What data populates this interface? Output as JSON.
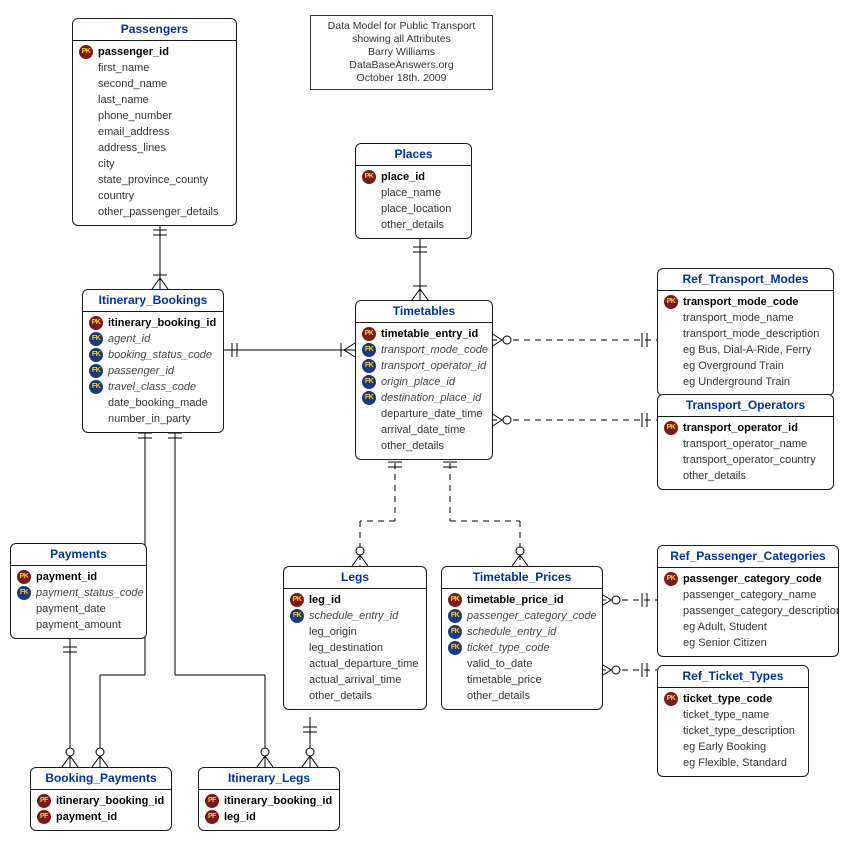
{
  "caption": {
    "line1": "Data Model for Public Transport",
    "line2": "showing all Attributes",
    "line3": "Barry Williams",
    "line4": "DataBaseAnswers.org",
    "line5": "October 18th. 2009"
  },
  "entities": {
    "passengers": {
      "title": "Passengers",
      "attrs": [
        {
          "key": "PK",
          "name": "passenger_id",
          "bold": true
        },
        {
          "key": null,
          "name": "first_name"
        },
        {
          "key": null,
          "name": "second_name"
        },
        {
          "key": null,
          "name": "last_name"
        },
        {
          "key": null,
          "name": "phone_number"
        },
        {
          "key": null,
          "name": "email_address"
        },
        {
          "key": null,
          "name": "address_lines"
        },
        {
          "key": null,
          "name": "city"
        },
        {
          "key": null,
          "name": "state_province_county"
        },
        {
          "key": null,
          "name": "country"
        },
        {
          "key": null,
          "name": "other_passenger_details"
        }
      ]
    },
    "itinerary_bookings": {
      "title": "Itinerary_Bookings",
      "attrs": [
        {
          "key": "PK",
          "name": "itinerary_booking_id",
          "bold": true
        },
        {
          "key": "FK",
          "name": "agent_id",
          "italic": true
        },
        {
          "key": "FK",
          "name": "booking_status_code",
          "italic": true
        },
        {
          "key": "FK",
          "name": "passenger_id",
          "italic": true
        },
        {
          "key": "FK",
          "name": "travel_class_code",
          "italic": true
        },
        {
          "key": null,
          "name": "date_booking_made"
        },
        {
          "key": null,
          "name": "number_in_party"
        }
      ]
    },
    "payments": {
      "title": "Payments",
      "attrs": [
        {
          "key": "PK",
          "name": "payment_id",
          "bold": true
        },
        {
          "key": "FK",
          "name": "payment_status_code",
          "italic": true
        },
        {
          "key": null,
          "name": "payment_date"
        },
        {
          "key": null,
          "name": "payment_amount"
        }
      ]
    },
    "booking_payments": {
      "title": "Booking_Payments",
      "attrs": [
        {
          "key": "PF",
          "name": "itinerary_booking_id",
          "bold": true
        },
        {
          "key": "PF",
          "name": "payment_id",
          "bold": true
        }
      ]
    },
    "itinerary_legs": {
      "title": "Itinerary_Legs",
      "attrs": [
        {
          "key": "PF",
          "name": "itinerary_booking_id",
          "bold": true
        },
        {
          "key": "PF",
          "name": "leg_id",
          "bold": true
        }
      ]
    },
    "places": {
      "title": "Places",
      "attrs": [
        {
          "key": "PK",
          "name": "place_id",
          "bold": true
        },
        {
          "key": null,
          "name": "place_name"
        },
        {
          "key": null,
          "name": "place_location"
        },
        {
          "key": null,
          "name": "other_details"
        }
      ]
    },
    "timetables": {
      "title": "Timetables",
      "attrs": [
        {
          "key": "PK",
          "name": "timetable_entry_id",
          "bold": true
        },
        {
          "key": "FK",
          "name": "transport_mode_code",
          "italic": true
        },
        {
          "key": "FK",
          "name": "transport_operator_id",
          "italic": true
        },
        {
          "key": "FK",
          "name": "origin_place_id",
          "italic": true
        },
        {
          "key": "FK",
          "name": "destination_place_id",
          "italic": true
        },
        {
          "key": null,
          "name": "departure_date_time"
        },
        {
          "key": null,
          "name": "arrival_date_time"
        },
        {
          "key": null,
          "name": "other_details"
        }
      ]
    },
    "legs": {
      "title": "Legs",
      "attrs": [
        {
          "key": "PK",
          "name": "leg_id",
          "bold": true
        },
        {
          "key": "FK",
          "name": "schedule_entry_id",
          "italic": true
        },
        {
          "key": null,
          "name": "leg_origin"
        },
        {
          "key": null,
          "name": "leg_destination"
        },
        {
          "key": null,
          "name": "actual_departure_time"
        },
        {
          "key": null,
          "name": "actual_arrival_time"
        },
        {
          "key": null,
          "name": "other_details"
        }
      ]
    },
    "timetable_prices": {
      "title": "Timetable_Prices",
      "attrs": [
        {
          "key": "PK",
          "name": "timetable_price_id",
          "bold": true
        },
        {
          "key": "FK",
          "name": "passenger_category_code",
          "italic": true
        },
        {
          "key": "FK",
          "name": "schedule_entry_id",
          "italic": true
        },
        {
          "key": "FK",
          "name": "ticket_type_code",
          "italic": true
        },
        {
          "key": null,
          "name": "valid_to_date"
        },
        {
          "key": null,
          "name": "timetable_price"
        },
        {
          "key": null,
          "name": "other_details"
        }
      ]
    },
    "ref_transport_modes": {
      "title": "Ref_Transport_Modes",
      "attrs": [
        {
          "key": "PK",
          "name": "transport_mode_code",
          "bold": true
        },
        {
          "key": null,
          "name": "transport_mode_name"
        },
        {
          "key": null,
          "name": "transport_mode_description"
        },
        {
          "key": null,
          "name": "eg Bus, Dial-A-Ride, Ferry"
        },
        {
          "key": null,
          "name": "eg Overground Train"
        },
        {
          "key": null,
          "name": "eg Underground Train"
        }
      ]
    },
    "transport_operators": {
      "title": "Transport_Operators",
      "attrs": [
        {
          "key": "PK",
          "name": "transport_operator_id",
          "bold": true
        },
        {
          "key": null,
          "name": "transport_operator_name"
        },
        {
          "key": null,
          "name": "transport_operator_country"
        },
        {
          "key": null,
          "name": "other_details"
        }
      ]
    },
    "ref_passenger_categories": {
      "title": "Ref_Passenger_Categories",
      "attrs": [
        {
          "key": "PK",
          "name": "passenger_category_code",
          "bold": true
        },
        {
          "key": null,
          "name": "passenger_category_name"
        },
        {
          "key": null,
          "name": "passenger_category_description"
        },
        {
          "key": null,
          "name": "eg Adult, Student"
        },
        {
          "key": null,
          "name": "eg Senior Citizen"
        }
      ]
    },
    "ref_ticket_types": {
      "title": "Ref_Ticket_Types",
      "attrs": [
        {
          "key": "PK",
          "name": "ticket_type_code",
          "bold": true
        },
        {
          "key": null,
          "name": "ticket_type_name"
        },
        {
          "key": null,
          "name": "ticket_type_description"
        },
        {
          "key": null,
          "name": "eg Early Booking"
        },
        {
          "key": null,
          "name": "eg Flexible, Standard"
        }
      ]
    }
  }
}
